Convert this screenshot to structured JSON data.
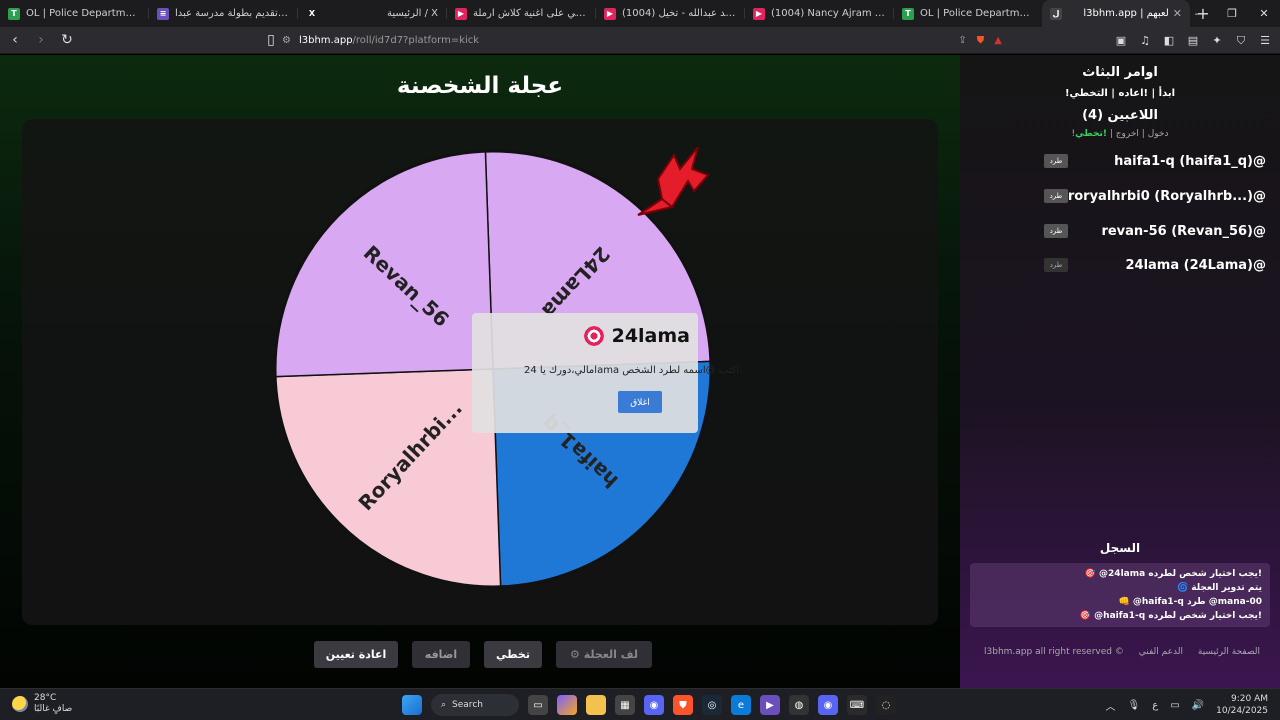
{
  "browser": {
    "tabs": [
      {
        "title": "OL | Police Department v2.0 - ...",
        "icon_color": "#2e9e4f",
        "icon_letter": "T"
      },
      {
        "title": "نموذج تقديم بطولة مدرسة عبدا...",
        "icon_color": "#6b4fbb",
        "icon_letter": "≡"
      },
      {
        "title": "الرئيسية / X",
        "icon_color": "#1c1c1f",
        "icon_letter": "X"
      },
      {
        "title": "ردة فعلي على اغنية كلاش ارملة",
        "icon_color": "#e0245e",
        "icon_letter": "▶"
      },
      {
        "title": "عبدالمجيد عبدالله - تخيل (1004)",
        "icon_color": "#e0245e",
        "icon_letter": "▶"
      },
      {
        "title": "(1004) Nancy Ajram - Ana ...",
        "icon_color": "#e0245e",
        "icon_letter": "▶"
      },
      {
        "title": "OL | Police Department v2.0 - ...",
        "icon_color": "#2e9e4f",
        "icon_letter": "T"
      },
      {
        "title": "l3bhm.app | لعبهم",
        "icon_color": "#333",
        "icon_letter": "ل"
      }
    ],
    "new_tab": "+",
    "url_host": "l3bhm.app",
    "url_path": "/roll/id7d7?platform=kick"
  },
  "main": {
    "title": "عجلة الشخصنة",
    "popup": {
      "name": "24lama",
      "message": "مالي،دورك يا 24lama اكتب @اسمه لطرد الشخص.",
      "close_label": "اغلاق"
    },
    "controls": [
      {
        "label": "⚙ لف العجلة",
        "width": 96
      },
      {
        "label": "تخطي",
        "width": 58
      },
      {
        "label": "اضافه",
        "width": 58
      },
      {
        "label": "اعادة تعيين",
        "width": 84
      }
    ]
  },
  "chart_data": {
    "type": "pie",
    "categories": [
      "24Lama",
      "haifa1_q",
      "Roryalhrbi...",
      "Revan_56"
    ],
    "values": [
      25,
      25,
      25,
      25
    ],
    "colors": [
      "#d9a8f2",
      "#1f78d6",
      "#f7cad6",
      "#d9a8f2"
    ]
  },
  "sidebar": {
    "commands_title": "اوامر البثاث",
    "commands": "!ابدأ | !اعاده | التخطي",
    "players_title": "اللاعبين (4)",
    "player_cmds": {
      "join": "!دخول",
      "leave": "اخروج",
      "skip": "!تخطي"
    },
    "kick_label": "طرد",
    "players": [
      {
        "name": "haifa1-q (haifa1_q)@"
      },
      {
        "name": "roryalhrbi0 (Roryalhrb...)@"
      },
      {
        "name": "revan-56 (Revan_56)@"
      },
      {
        "name": "24lama (24Lama)@"
      }
    ],
    "log_title": "السجل",
    "log": [
      "🎯 @24lama يجب اختيار شخص لطرده!",
      "🌀 يتم تدوير العجلة",
      "👊 @haifa1-q طرد @mana-00",
      "🎯 @haifa1-q يجب اختيار شخص لطرده!"
    ],
    "footer": {
      "home": "الصفحة الرئيسية",
      "support": "الدعم الفني",
      "rights": "l3bhm.app all right reserved ©"
    }
  },
  "taskbar": {
    "temp": "28°C",
    "weather": "صافٍ غالبًا",
    "search": "Search",
    "lang": "ع",
    "time": "9:20 AM",
    "date": "10/24/2025"
  }
}
